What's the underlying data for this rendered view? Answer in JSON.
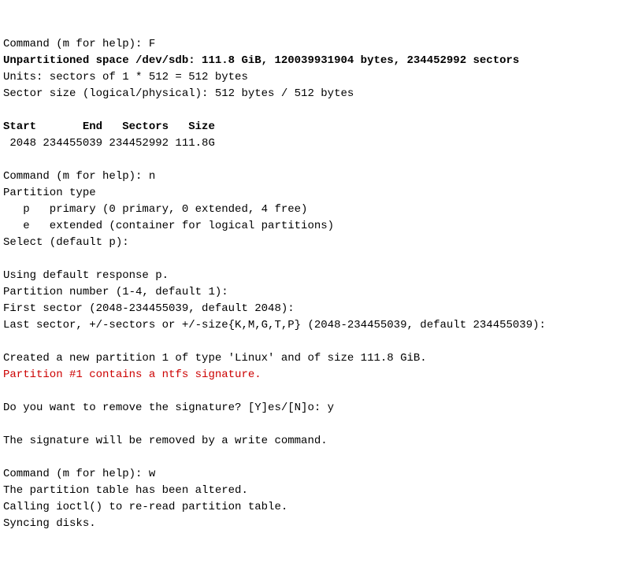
{
  "lines": [
    {
      "text": "Command (m for help): F"
    },
    {
      "text": "Unpartitioned space /dev/sdb: 111.8 GiB, 120039931904 bytes, 234452992 sectors",
      "bold": true
    },
    {
      "text": "Units: sectors of 1 * 512 = 512 bytes"
    },
    {
      "text": "Sector size (logical/physical): 512 bytes / 512 bytes"
    },
    {
      "text": ""
    },
    {
      "text": "Start       End   Sectors   Size",
      "bold": true
    },
    {
      "text": " 2048 234455039 234452992 111.8G"
    },
    {
      "text": ""
    },
    {
      "text": "Command (m for help): n"
    },
    {
      "text": "Partition type"
    },
    {
      "text": "   p   primary (0 primary, 0 extended, 4 free)"
    },
    {
      "text": "   e   extended (container for logical partitions)"
    },
    {
      "text": "Select (default p): "
    },
    {
      "text": ""
    },
    {
      "text": "Using default response p."
    },
    {
      "text": "Partition number (1-4, default 1): "
    },
    {
      "text": "First sector (2048-234455039, default 2048): "
    },
    {
      "text": "Last sector, +/-sectors or +/-size{K,M,G,T,P} (2048-234455039, default 234455039): "
    },
    {
      "text": ""
    },
    {
      "text": "Created a new partition 1 of type 'Linux' and of size 111.8 GiB."
    },
    {
      "text": "Partition #1 contains a ntfs signature.",
      "red": true
    },
    {
      "text": ""
    },
    {
      "text": "Do you want to remove the signature? [Y]es/[N]o: y"
    },
    {
      "text": ""
    },
    {
      "text": "The signature will be removed by a write command."
    },
    {
      "text": ""
    },
    {
      "text": "Command (m for help): w"
    },
    {
      "text": "The partition table has been altered."
    },
    {
      "text": "Calling ioctl() to re-read partition table."
    },
    {
      "text": "Syncing disks."
    }
  ]
}
